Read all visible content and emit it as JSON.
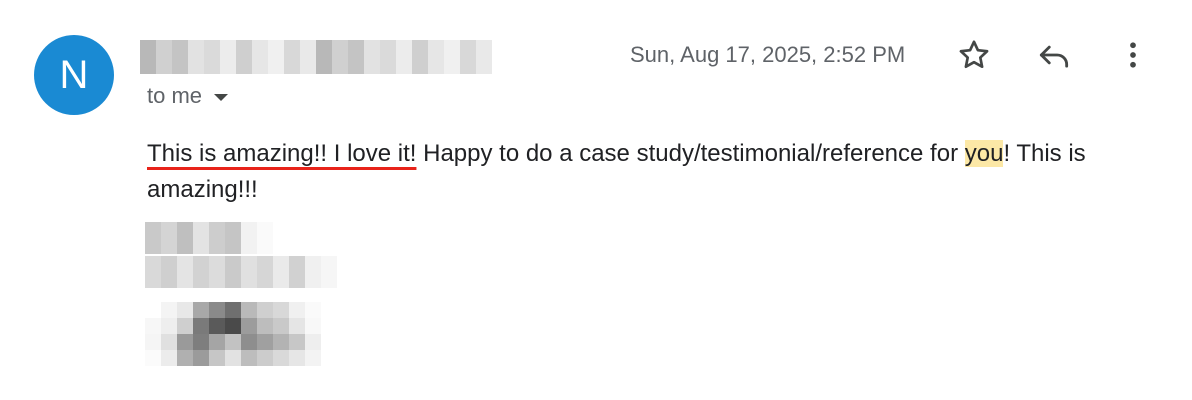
{
  "avatar": {
    "initial": "N",
    "color": "#1a8ad3"
  },
  "header": {
    "recipient_label": "to me",
    "timestamp": "Sun, Aug 17, 2025, 2:52 PM"
  },
  "actions": {
    "star_icon": "star-icon",
    "reply_icon": "reply-icon",
    "more_icon": "more-vert-icon"
  },
  "message": {
    "underlined_part": "This is amazing!! I love it!",
    "middle_part": " Happy to do a case study/testimonial/reference for ",
    "highlighted_word": "you",
    "end_part": "! This is amazing!!!"
  },
  "colors": {
    "underline": "#e8231a",
    "highlight": "#fce8a6"
  }
}
